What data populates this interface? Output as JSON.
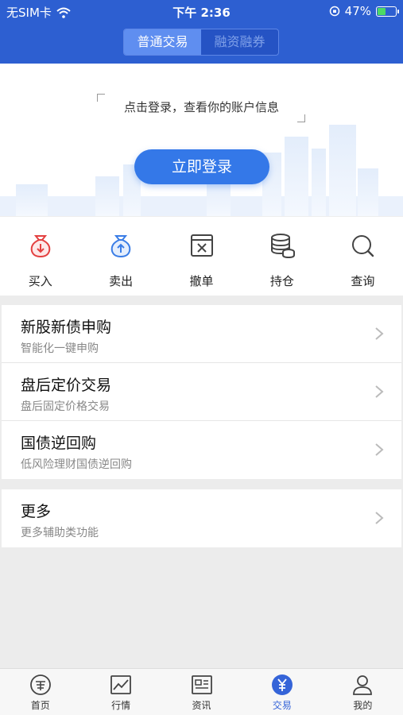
{
  "status_bar": {
    "carrier": "无SIM卡",
    "time": "下午 2:36",
    "battery": "47%"
  },
  "segment": {
    "tabs": [
      "普通交易",
      "融资融券"
    ],
    "active": 0
  },
  "login": {
    "prompt": "点击登录，查看你的账户信息",
    "button": "立即登录"
  },
  "actions": [
    {
      "label": "买入",
      "icon": "buy-moneybag-icon"
    },
    {
      "label": "卖出",
      "icon": "sell-moneybag-icon"
    },
    {
      "label": "撤单",
      "icon": "cancel-order-icon"
    },
    {
      "label": "持仓",
      "icon": "coins-stack-icon"
    },
    {
      "label": "查询",
      "icon": "search-icon"
    }
  ],
  "menu_groups": [
    [
      {
        "title": "新股新债申购",
        "subtitle": "智能化一键申购"
      },
      {
        "title": "盘后定价交易",
        "subtitle": "盘后固定价格交易"
      },
      {
        "title": "国债逆回购",
        "subtitle": "低风险理财国债逆回购"
      }
    ],
    [
      {
        "title": "更多",
        "subtitle": "更多辅助类功能"
      }
    ]
  ],
  "tabbar": [
    {
      "label": "首页",
      "icon": "coupon-icon"
    },
    {
      "label": "行情",
      "icon": "chart-icon"
    },
    {
      "label": "资讯",
      "icon": "news-icon"
    },
    {
      "label": "交易",
      "icon": "yen-icon",
      "active": true
    },
    {
      "label": "我的",
      "icon": "person-icon"
    }
  ],
  "colors": {
    "header": "#2d5fd1",
    "accent": "#3478e8",
    "buy": "#e34040",
    "sell": "#3a7de6"
  }
}
